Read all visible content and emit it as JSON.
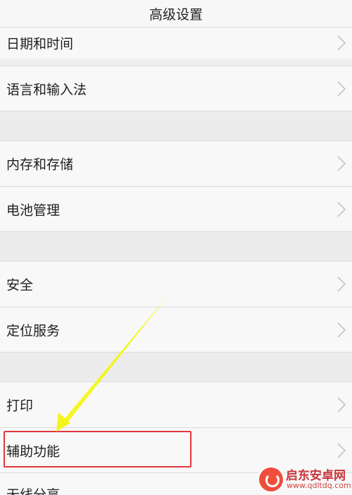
{
  "header": {
    "title": "高级设置"
  },
  "rows": [
    {
      "label": "日期和时间",
      "icon": "chevron-right-icon"
    },
    {
      "label": "语言和输入法",
      "icon": "chevron-right-icon"
    },
    {
      "label": "内存和存储",
      "icon": "chevron-right-icon"
    },
    {
      "label": "电池管理",
      "icon": "chevron-right-icon"
    },
    {
      "label": "安全",
      "icon": "chevron-right-icon"
    },
    {
      "label": "定位服务",
      "icon": "chevron-right-icon"
    },
    {
      "label": "打印",
      "icon": "chevron-right-icon"
    },
    {
      "label": "辅助功能",
      "icon": "chevron-right-icon"
    },
    {
      "label": "无线分享",
      "icon": "chevron-right-icon"
    }
  ],
  "annotation": {
    "highlight_color": "#e0383f",
    "arrow_color": "#f4f51a"
  },
  "watermark": {
    "name": "启东安卓网",
    "url": "www.qdltdq.com"
  }
}
